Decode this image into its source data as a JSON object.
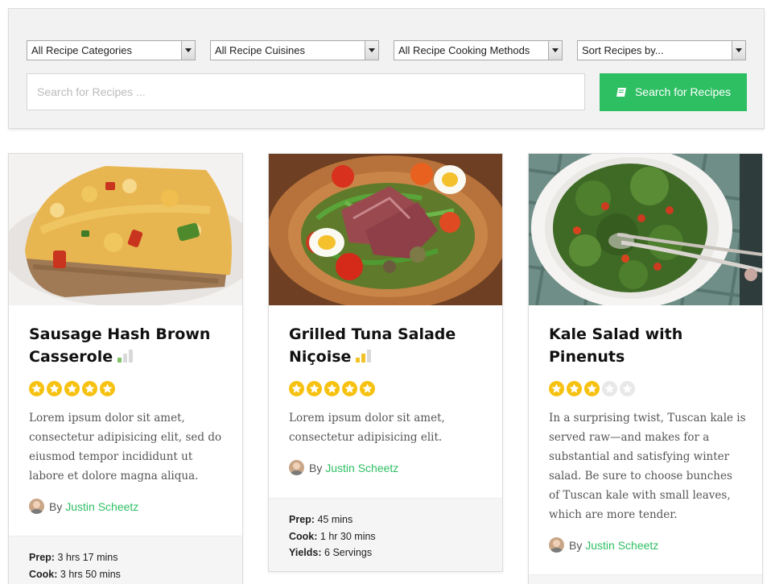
{
  "filters": {
    "categories": "All Recipe Categories",
    "cuisines": "All Recipe Cuisines",
    "methods": "All Recipe Cooking Methods",
    "sort": "Sort Recipes by..."
  },
  "search": {
    "placeholder": "Search for Recipes ...",
    "button_label": "Search for Recipes"
  },
  "colors": {
    "accent": "#2ebf63",
    "star": "#f6c10f"
  },
  "recipes": [
    {
      "title": "Sausage Hash Brown Casserole",
      "difficulty": "easy",
      "rating": 5,
      "description": "Lorem ipsum dolor sit amet, consectetur adipisicing elit, sed do eiusmod tempor incididunt ut labore et dolore magna aliqua.",
      "author_prefix": "By",
      "author": "Justin Scheetz",
      "meta": [
        {
          "label": "Prep:",
          "value": "3 hrs 17 mins"
        },
        {
          "label": "Cook:",
          "value": "3 hrs 50 mins"
        }
      ]
    },
    {
      "title": "Grilled Tuna Salade Niçoise",
      "difficulty": "medium",
      "rating": 5,
      "description": "Lorem ipsum dolor sit amet, consectetur adipisicing elit.",
      "author_prefix": "By",
      "author": "Justin Scheetz",
      "meta": [
        {
          "label": "Prep:",
          "value": "45 mins"
        },
        {
          "label": "Cook:",
          "value": "1 hr 30 mins"
        },
        {
          "label": "Yields:",
          "value": "6 Servings"
        }
      ]
    },
    {
      "title": "Kale Salad with Pinenuts",
      "difficulty": "",
      "rating": 3,
      "description": "In a surprising twist, Tuscan kale is served raw—and makes for a substantial and satisfying winter salad. Be sure to choose bunches of Tuscan kale with small leaves, which are more tender.",
      "author_prefix": "By",
      "author": "Justin Scheetz",
      "meta": []
    }
  ]
}
